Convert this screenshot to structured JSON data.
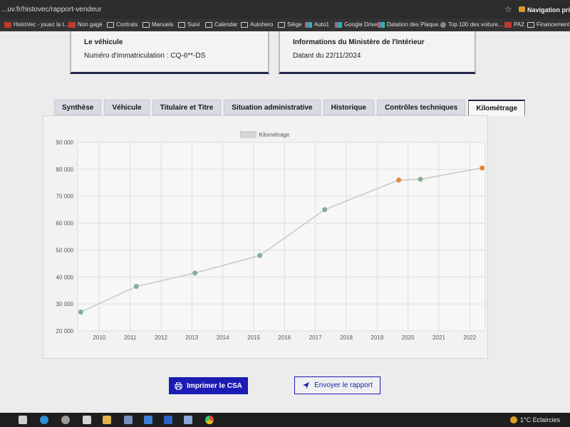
{
  "browser": {
    "url": "...uv.fr/histovec/rapport-vendeur",
    "profile_label": "Navigation privée",
    "bookmarks": [
      {
        "label": "HistoVec - jouez la t...",
        "icon": "red"
      },
      {
        "label": "Non gagé",
        "icon": "red"
      },
      {
        "label": "Contrats",
        "icon": "folder"
      },
      {
        "label": "Manuels",
        "icon": "folder"
      },
      {
        "label": "Suivi",
        "icon": "folder"
      },
      {
        "label": "Calendar",
        "icon": "folder"
      },
      {
        "label": "Autohero",
        "icon": "folder"
      },
      {
        "label": "Siège",
        "icon": "folder"
      },
      {
        "label": "Auto1",
        "icon": "color"
      },
      {
        "label": "Google Drive",
        "icon": "color"
      },
      {
        "label": "Datation des Plaque...",
        "icon": "color"
      },
      {
        "label": "Top 100 des voiture...",
        "icon": "round"
      },
      {
        "label": "PA2",
        "icon": "red"
      },
      {
        "label": "Financement",
        "icon": "folder"
      }
    ]
  },
  "vehicle_box": {
    "title": "Le véhicule",
    "registration_label": "Numéro d'immatriculation : CQ-6**-DS"
  },
  "ministry_box": {
    "title": "Informations du Ministère de l'Intérieur",
    "date_label": "Datant du 22/11/2024"
  },
  "tabs": [
    {
      "label": "Synthèse",
      "active": false
    },
    {
      "label": "Véhicule",
      "active": false
    },
    {
      "label": "Titulaire et Titre",
      "active": false
    },
    {
      "label": "Situation administrative",
      "active": false
    },
    {
      "label": "Historique",
      "active": false
    },
    {
      "label": "Contrôles techniques",
      "active": false
    },
    {
      "label": "Kilométrage",
      "active": true
    }
  ],
  "chart_data": {
    "type": "scatter",
    "title": "",
    "xlabel": "",
    "ylabel": "",
    "legend": [
      "Kilométrage"
    ],
    "legend_position": "top-center",
    "grid": true,
    "xlim": [
      2009.3,
      2022.5
    ],
    "ylim": [
      20000,
      90000
    ],
    "x_ticks": [
      "2010",
      "2011",
      "2012",
      "2013",
      "2014",
      "2015",
      "2016",
      "2017",
      "2018",
      "2019",
      "2020",
      "2021",
      "2022"
    ],
    "y_ticks": [
      "20 000",
      "30 000",
      "40 000",
      "50 000",
      "60 000",
      "70 000",
      "80 000",
      "90 000"
    ],
    "series": [
      {
        "name": "Kilométrage",
        "line_color": "#c8c8c8",
        "points": [
          {
            "x": 2009.4,
            "y": 27000,
            "color": "#7fb08f"
          },
          {
            "x": 2011.2,
            "y": 36500,
            "color": "#7fb08f"
          },
          {
            "x": 2013.1,
            "y": 41500,
            "color": "#7fb08f"
          },
          {
            "x": 2015.2,
            "y": 48000,
            "color": "#7fb08f"
          },
          {
            "x": 2017.3,
            "y": 65000,
            "color": "#7fb08f"
          },
          {
            "x": 2019.7,
            "y": 76000,
            "color": "#e08a3c"
          },
          {
            "x": 2020.4,
            "y": 76300,
            "color": "#7fb08f"
          },
          {
            "x": 2022.4,
            "y": 80500,
            "color": "#e08a3c"
          }
        ]
      }
    ]
  },
  "actions": {
    "print_label": "Imprimer le CSA",
    "send_label": "Envoyer le rapport"
  },
  "taskbar": {
    "weather_label": "1°C  Eclaircies",
    "apps": [
      "start-icon",
      "task-view-icon",
      "edge-icon",
      "app-icon",
      "explorer-icon",
      "store-icon",
      "mail-icon",
      "l-icon",
      "tablet-icon",
      "chrome-icon"
    ]
  }
}
